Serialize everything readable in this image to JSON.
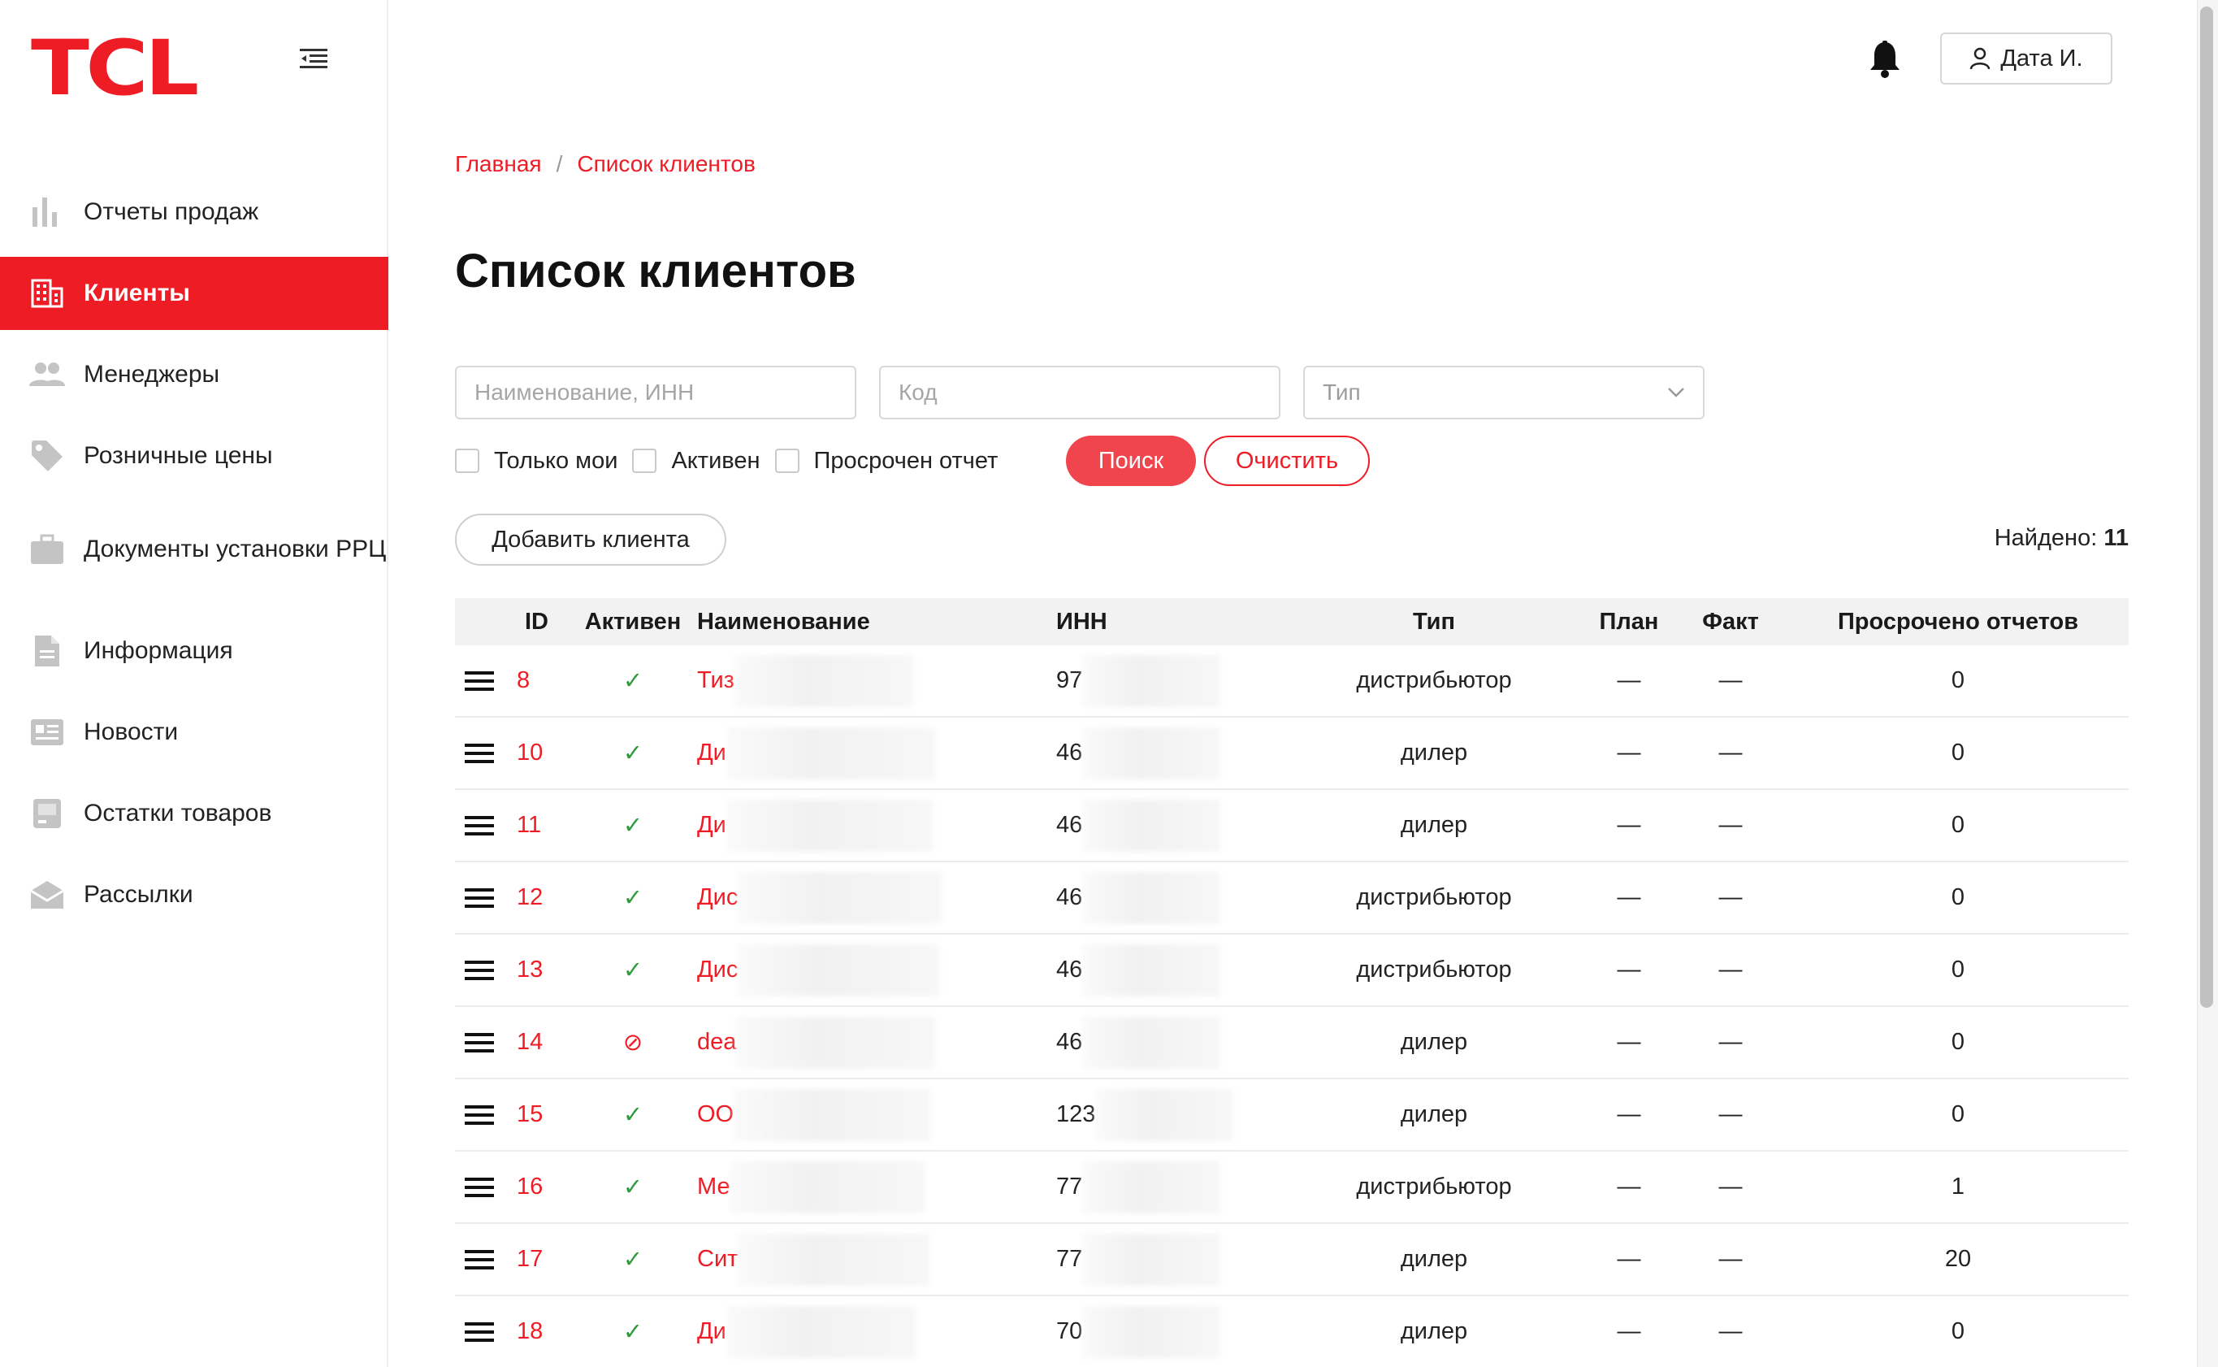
{
  "brand": {
    "logo_text": "TCL",
    "accent_color": "#ee1c25"
  },
  "header": {
    "user_label": "Дата И.",
    "bell_icon": "bell-icon",
    "user_icon": "user-icon"
  },
  "sidebar": {
    "items": [
      {
        "label": "Отчеты продаж",
        "icon": "bar-chart-icon",
        "active": false
      },
      {
        "label": "Клиенты",
        "icon": "building-icon",
        "active": true
      },
      {
        "label": "Менеджеры",
        "icon": "people-icon",
        "active": false
      },
      {
        "label": "Розничные цены",
        "icon": "tag-icon",
        "active": false
      },
      {
        "label": "Документы установки РРЦ",
        "icon": "briefcase-icon",
        "active": false
      },
      {
        "label": "Информация",
        "icon": "document-icon",
        "active": false
      },
      {
        "label": "Новости",
        "icon": "news-icon",
        "active": false
      },
      {
        "label": "Остатки товаров",
        "icon": "inventory-icon",
        "active": false
      },
      {
        "label": "Рассылки",
        "icon": "mail-icon",
        "active": false
      }
    ]
  },
  "breadcrumb": {
    "home": "Главная",
    "separator": "/",
    "current": "Список клиентов"
  },
  "page": {
    "title": "Список клиентов"
  },
  "filters": {
    "name_placeholder": "Наименование, ИНН",
    "code_placeholder": "Код",
    "type_placeholder": "Тип",
    "only_mine": "Только мои",
    "active": "Активен",
    "overdue": "Просрочен отчет",
    "search_button": "Поиск",
    "clear_button": "Очистить"
  },
  "actions": {
    "add_client": "Добавить клиента"
  },
  "found": {
    "label": "Найдено:",
    "count": "11"
  },
  "table": {
    "headers": {
      "id": "ID",
      "active": "Активен",
      "name": "Наименование",
      "inn": "ИНН",
      "type": "Тип",
      "plan": "План",
      "fact": "Факт",
      "overdue": "Просрочено отчетов"
    },
    "rows": [
      {
        "id": "8",
        "active": "✓",
        "name": "Тиз",
        "inn": "97",
        "type": "дистрибьютор",
        "plan": "—",
        "fact": "—",
        "overdue": "0"
      },
      {
        "id": "10",
        "active": "✓",
        "name": "Ди",
        "inn": "46",
        "type": "дилер",
        "plan": "—",
        "fact": "—",
        "overdue": "0"
      },
      {
        "id": "11",
        "active": "✓",
        "name": "Ди",
        "inn": "46",
        "type": "дилер",
        "plan": "—",
        "fact": "—",
        "overdue": "0"
      },
      {
        "id": "12",
        "active": "✓",
        "name": "Дис",
        "inn": "46",
        "type": "дистрибьютор",
        "plan": "—",
        "fact": "—",
        "overdue": "0"
      },
      {
        "id": "13",
        "active": "✓",
        "name": "Дис",
        "inn": "46",
        "type": "дистрибьютор",
        "plan": "—",
        "fact": "—",
        "overdue": "0"
      },
      {
        "id": "14",
        "active": "⊘",
        "name": "dea",
        "inn": "46",
        "type": "дилер",
        "plan": "—",
        "fact": "—",
        "overdue": "0"
      },
      {
        "id": "15",
        "active": "✓",
        "name": "ОО",
        "inn": "123",
        "type": "дилер",
        "plan": "—",
        "fact": "—",
        "overdue": "0"
      },
      {
        "id": "16",
        "active": "✓",
        "name": "Ме",
        "inn": "77",
        "type": "дистрибьютор",
        "plan": "—",
        "fact": "—",
        "overdue": "1"
      },
      {
        "id": "17",
        "active": "✓",
        "name": "Сит",
        "inn": "77",
        "type": "дилер",
        "plan": "—",
        "fact": "—",
        "overdue": "20"
      },
      {
        "id": "18",
        "active": "✓",
        "name": "Ди",
        "inn": "70",
        "type": "дилер",
        "plan": "—",
        "fact": "—",
        "overdue": "0"
      }
    ]
  },
  "colors": {
    "active_check": "#2e9b3c",
    "inactive": "#ee1c25"
  }
}
